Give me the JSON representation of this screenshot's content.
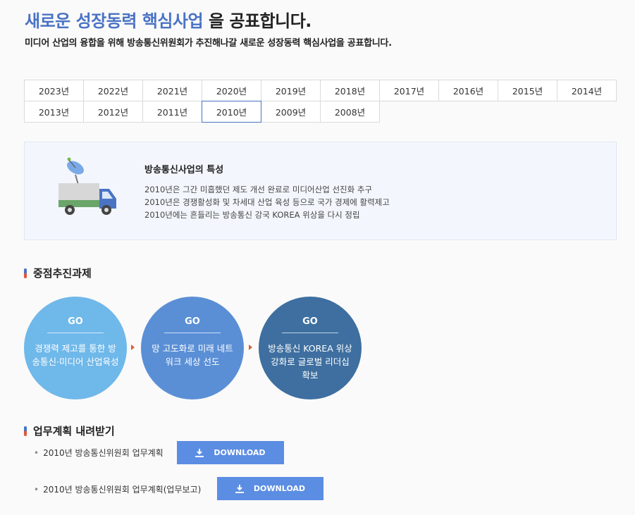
{
  "header": {
    "title_highlight": "새로운 성장동력 핵심사업",
    "title_rest": " 을 공표합니다.",
    "subtitle": "미디어 산업의 융합을 위해 방송통신위원회가 추진해나갈 새로운 성장동력 핵심사업을 공표합니다."
  },
  "years": [
    "2023년",
    "2022년",
    "2021년",
    "2020년",
    "2019년",
    "2018년",
    "2017년",
    "2016년",
    "2015년",
    "2014년",
    "2013년",
    "2012년",
    "2011년",
    "2010년",
    "2009년",
    "2008년"
  ],
  "selected_year": "2010년",
  "feature": {
    "title": "방송통신사업의 특성",
    "lines": [
      "2010년은 그간 미흡했던 제도 개선 완료로 미디어산업 선진화 추구",
      "2010년은 경쟁활성화 및 차세대 산업 육성 등으로 국가 경제에 활력제고",
      "2010년에는 흔들리는 방송통신 강국 KOREA 위상을 다시 정립"
    ],
    "colors": {
      "box_bg": "#f3f7fd",
      "truck_body": "#d7d7d7",
      "truck_cab": "#4a73c4",
      "truck_stripe": "#6aa56a"
    }
  },
  "tasks": {
    "heading": "중점추진과제",
    "items": [
      {
        "go": "GO",
        "text": "경쟁력 제고를 통한 방송통신·미디어 산업육성",
        "color": "#6fb8ea"
      },
      {
        "go": "GO",
        "text": "망 고도화로 미래 네트워크 세상 선도",
        "color": "#5a8fd6"
      },
      {
        "go": "GO",
        "text": "방송통신 KOREA 위상 강화로 글로벌 리더십 확보",
        "color": "#3e6fa0"
      }
    ]
  },
  "downloads": {
    "heading": "업무계획 내려받기",
    "items": [
      {
        "label": "2010년 방송통신위원회 업무계획",
        "button": "DOWNLOAD"
      },
      {
        "label": "2010년 방송통신위원회 업무계획(업무보고)",
        "button": "DOWNLOAD"
      }
    ]
  },
  "colors": {
    "accent": "#4a73c4",
    "download_button": "#5b8de3",
    "arrow": "#d2643a"
  }
}
